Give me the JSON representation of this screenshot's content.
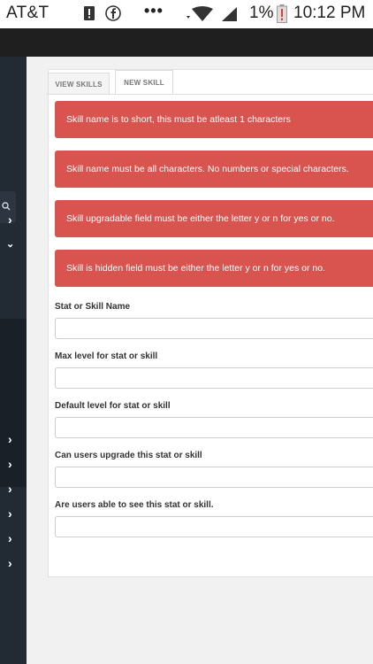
{
  "status_bar": {
    "carrier": "AT&T",
    "dots": "•••",
    "battery_percent": "1%",
    "time": "10:12 PM",
    "icons": [
      "sim-alert-icon",
      "facebook-icon",
      "wifi-icon",
      "signal-icon",
      "battery-low-icon"
    ]
  },
  "sidebar": {
    "icons": [
      "search-icon",
      "chevron-right-icon",
      "chevron-down-icon",
      "chevron-right-icon",
      "chevron-right-icon",
      "chevron-right-icon",
      "chevron-right-icon",
      "chevron-right-icon",
      "chevron-right-icon"
    ]
  },
  "tabs": [
    {
      "label": "VIEW SKILLS",
      "active": false
    },
    {
      "label": "NEW SKILL",
      "active": true
    }
  ],
  "alerts": [
    "Skill name is to short, this must be atleast 1 characters",
    "Skill name must be all characters. No numbers or special characters.",
    "Skill upgradable field must be either the letter y or n for yes or no.",
    "Skill is hidden field must be either the letter y or n for yes or no."
  ],
  "form": {
    "fields": [
      {
        "label": "Stat or Skill Name",
        "value": ""
      },
      {
        "label": "Max level for stat or skill",
        "value": ""
      },
      {
        "label": "Default level for stat or skill",
        "value": ""
      },
      {
        "label": "Can users upgrade this stat or skill",
        "value": ""
      },
      {
        "label": "Are users able to see this stat or skill.",
        "value": ""
      }
    ]
  },
  "colors": {
    "alert": "#d9534f",
    "sidebar": "#222a33",
    "topbar": "#1f1f1f"
  }
}
